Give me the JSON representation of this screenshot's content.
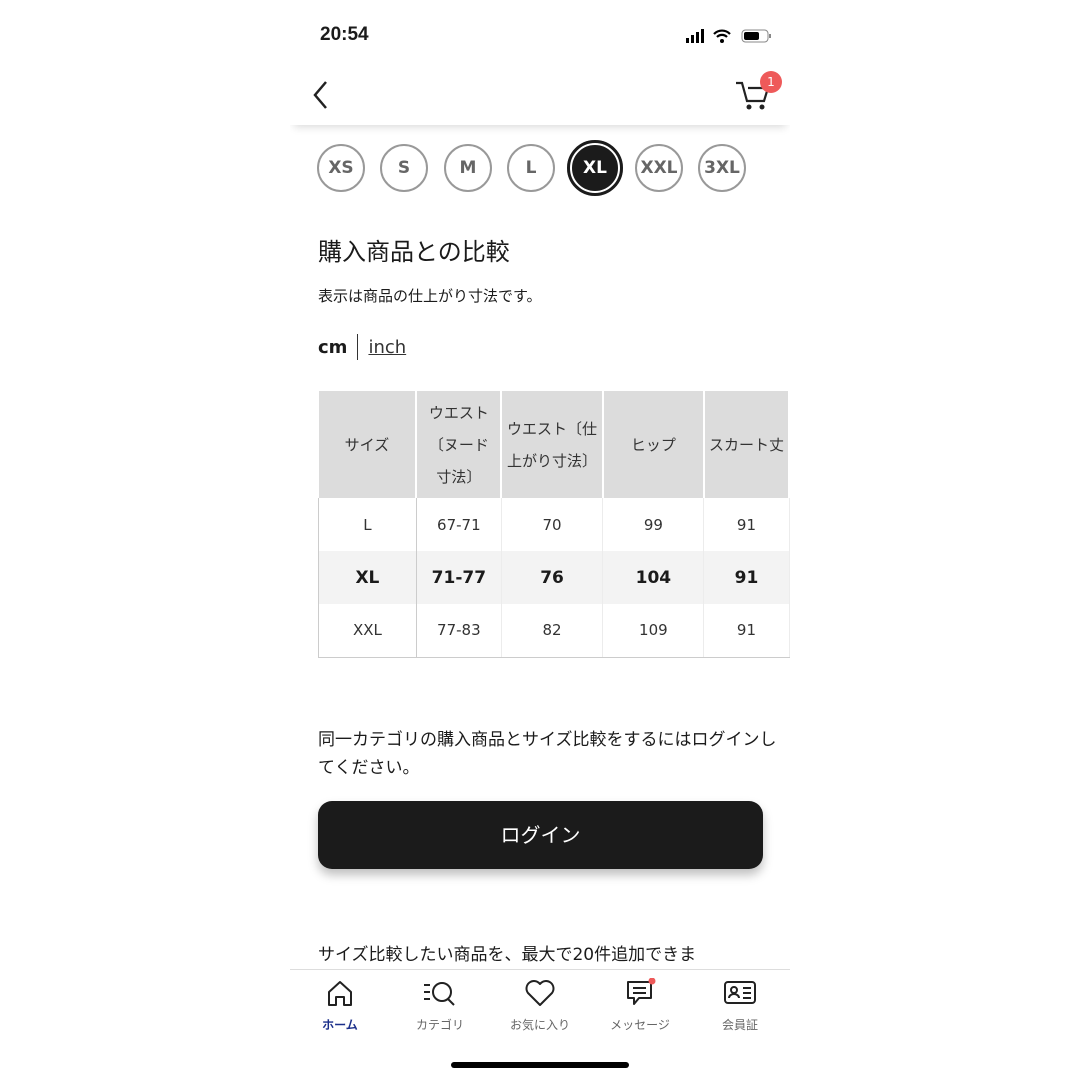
{
  "status": {
    "time": "20:54"
  },
  "header": {
    "cart_count": "1"
  },
  "sizes": [
    "XS",
    "S",
    "M",
    "L",
    "XL",
    "XXL",
    "3XL"
  ],
  "selected_size": "XL",
  "title": "購入商品との比較",
  "subtitle": "表示は商品の仕上がり寸法です。",
  "units": {
    "cm": "cm",
    "inch": "inch",
    "selected": "cm"
  },
  "table": {
    "headers": [
      "サイズ",
      "ウエスト〔ヌード寸法〕",
      "ウエスト〔仕上がり寸法〕",
      "ヒップ",
      "スカート丈"
    ],
    "rows": [
      [
        "L",
        "67-71",
        "70",
        "99",
        "91"
      ],
      [
        "XL",
        "71-77",
        "76",
        "104",
        "91"
      ],
      [
        "XXL",
        "77-83",
        "82",
        "109",
        "91"
      ]
    ],
    "highlight_row": "XL"
  },
  "login_prompt": "同一カテゴリの購入商品とサイズ比較をするにはログインしてください。",
  "login_label": "ログイン",
  "compare_note": "サイズ比較したい商品を、最大で20件追加できま",
  "nav": {
    "items": [
      {
        "label": "ホーム",
        "icon": "home-icon",
        "active": true
      },
      {
        "label": "カテゴリ",
        "icon": "category-search-icon"
      },
      {
        "label": "お気に入り",
        "icon": "heart-icon"
      },
      {
        "label": "メッセージ",
        "icon": "message-icon",
        "dot": true
      },
      {
        "label": "会員証",
        "icon": "member-card-icon"
      }
    ]
  },
  "colors": {
    "accent": "#1b2f8a",
    "badge": "#ee5a5a",
    "button": "#1b1b1b"
  }
}
